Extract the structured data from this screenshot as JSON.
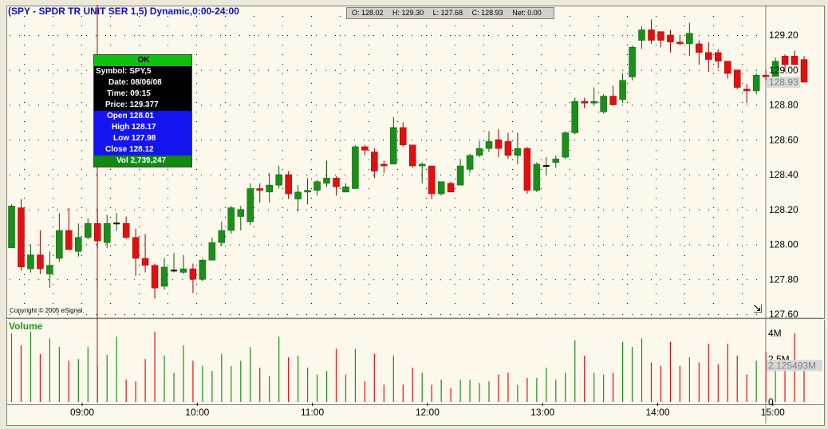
{
  "window": {
    "title": "(SPY - SPDR TR UNIT SER 1,5) Dynamic,0:00-24:00",
    "copyright": "Copyright © 2005 eSignal.",
    "volume_label": "Volume"
  },
  "ohlc_status": {
    "open": "O: 128.02",
    "high": "H: 129.30",
    "low": "L: 127.68",
    "close": "C: 128.93",
    "net": "Net:  0.00"
  },
  "cursor_popup": {
    "ok": "OK",
    "symbol": "Symbol: SPY,5",
    "date": "Date: 08/06/08",
    "time": "Time: 09:15",
    "price": "Price: 129.377",
    "open": "Open 128.01",
    "high": "High 128.17",
    "low": "Low 127.98",
    "close": "Close 128.12",
    "vol": "Vol 2,739,247"
  },
  "price_axis": {
    "ticks": [
      "129.20",
      "129.00",
      "128.80",
      "128.60",
      "128.40",
      "128.20",
      "128.00",
      "127.80",
      "127.60"
    ],
    "current_price_label": "128.93"
  },
  "volume_axis": {
    "ticks": [
      "4M",
      "2.5M",
      "0"
    ],
    "current_volume_label": "2.125493M"
  },
  "time_axis": {
    "ticks": [
      "09:00",
      "10:00",
      "11:00",
      "12:00",
      "13:00",
      "14:00",
      "15:00"
    ]
  },
  "colors": {
    "up": "#1a8f1a",
    "down": "#e01010",
    "background": "#fcf8ec",
    "grid_dot": "#000000"
  },
  "chart_data": {
    "type": "candlestick",
    "interval": "5 min",
    "x_start": "08:35",
    "ylim": [
      127.6,
      129.3
    ],
    "volume_ylim": [
      0,
      4300000
    ],
    "candles": [
      {
        "o": 127.98,
        "h": 128.23,
        "l": 127.98,
        "c": 128.22
      },
      {
        "o": 128.21,
        "h": 128.26,
        "l": 127.85,
        "c": 127.87
      },
      {
        "o": 127.86,
        "h": 128.0,
        "l": 127.84,
        "c": 127.94
      },
      {
        "o": 127.94,
        "h": 128.08,
        "l": 127.83,
        "c": 127.86
      },
      {
        "o": 127.83,
        "h": 127.96,
        "l": 127.75,
        "c": 127.88
      },
      {
        "o": 127.92,
        "h": 128.18,
        "l": 127.9,
        "c": 128.08
      },
      {
        "o": 128.08,
        "h": 128.21,
        "l": 128.03,
        "c": 127.97
      },
      {
        "o": 127.96,
        "h": 128.12,
        "l": 127.93,
        "c": 128.04
      },
      {
        "o": 128.04,
        "h": 128.15,
        "l": 128.03,
        "c": 128.12
      },
      {
        "o": 128.12,
        "h": 128.2,
        "l": 127.98,
        "c": 128.02
      },
      {
        "o": 128.01,
        "h": 128.17,
        "l": 127.98,
        "c": 128.12
      },
      {
        "o": 128.12,
        "h": 128.18,
        "l": 128.08,
        "c": 128.12
      },
      {
        "o": 128.12,
        "h": 128.16,
        "l": 128.03,
        "c": 128.04
      },
      {
        "o": 128.04,
        "h": 128.09,
        "l": 127.82,
        "c": 127.92
      },
      {
        "o": 127.92,
        "h": 128.06,
        "l": 127.84,
        "c": 127.88
      },
      {
        "o": 127.88,
        "h": 127.89,
        "l": 127.69,
        "c": 127.75
      },
      {
        "o": 127.76,
        "h": 127.92,
        "l": 127.74,
        "c": 127.87
      },
      {
        "o": 127.85,
        "h": 127.95,
        "l": 127.84,
        "c": 127.85
      },
      {
        "o": 127.84,
        "h": 127.94,
        "l": 127.83,
        "c": 127.86
      },
      {
        "o": 127.86,
        "h": 127.89,
        "l": 127.72,
        "c": 127.8
      },
      {
        "o": 127.8,
        "h": 127.92,
        "l": 127.79,
        "c": 127.91
      },
      {
        "o": 127.91,
        "h": 128.04,
        "l": 127.91,
        "c": 128.01
      },
      {
        "o": 128.01,
        "h": 128.13,
        "l": 127.99,
        "c": 128.08
      },
      {
        "o": 128.08,
        "h": 128.22,
        "l": 128.06,
        "c": 128.21
      },
      {
        "o": 128.16,
        "h": 128.22,
        "l": 128.08,
        "c": 128.2
      },
      {
        "o": 128.13,
        "h": 128.35,
        "l": 128.11,
        "c": 128.32
      },
      {
        "o": 128.32,
        "h": 128.35,
        "l": 128.24,
        "c": 128.31
      },
      {
        "o": 128.3,
        "h": 128.41,
        "l": 128.24,
        "c": 128.34
      },
      {
        "o": 128.34,
        "h": 128.45,
        "l": 128.32,
        "c": 128.4
      },
      {
        "o": 128.4,
        "h": 128.42,
        "l": 128.26,
        "c": 128.29
      },
      {
        "o": 128.26,
        "h": 128.34,
        "l": 128.19,
        "c": 128.3
      },
      {
        "o": 128.3,
        "h": 128.38,
        "l": 128.23,
        "c": 128.31
      },
      {
        "o": 128.31,
        "h": 128.37,
        "l": 128.28,
        "c": 128.36
      },
      {
        "o": 128.35,
        "h": 128.48,
        "l": 128.33,
        "c": 128.38
      },
      {
        "o": 128.38,
        "h": 128.39,
        "l": 128.28,
        "c": 128.33
      },
      {
        "o": 128.3,
        "h": 128.35,
        "l": 128.3,
        "c": 128.33
      },
      {
        "o": 128.32,
        "h": 128.57,
        "l": 128.32,
        "c": 128.56
      },
      {
        "o": 128.56,
        "h": 128.57,
        "l": 128.51,
        "c": 128.54
      },
      {
        "o": 128.53,
        "h": 128.55,
        "l": 128.38,
        "c": 128.42
      },
      {
        "o": 128.46,
        "h": 128.48,
        "l": 128.41,
        "c": 128.45
      },
      {
        "o": 128.46,
        "h": 128.73,
        "l": 128.46,
        "c": 128.67
      },
      {
        "o": 128.67,
        "h": 128.7,
        "l": 128.56,
        "c": 128.57
      },
      {
        "o": 128.57,
        "h": 128.57,
        "l": 128.44,
        "c": 128.45
      },
      {
        "o": 128.45,
        "h": 128.47,
        "l": 128.35,
        "c": 128.46
      },
      {
        "o": 128.45,
        "h": 128.45,
        "l": 128.26,
        "c": 128.29
      },
      {
        "o": 128.29,
        "h": 128.36,
        "l": 128.28,
        "c": 128.36
      },
      {
        "o": 128.35,
        "h": 128.36,
        "l": 128.3,
        "c": 128.3
      },
      {
        "o": 128.34,
        "h": 128.49,
        "l": 128.34,
        "c": 128.45
      },
      {
        "o": 128.43,
        "h": 128.52,
        "l": 128.41,
        "c": 128.51
      },
      {
        "o": 128.51,
        "h": 128.59,
        "l": 128.5,
        "c": 128.55
      },
      {
        "o": 128.55,
        "h": 128.65,
        "l": 128.53,
        "c": 128.59
      },
      {
        "o": 128.6,
        "h": 128.66,
        "l": 128.5,
        "c": 128.55
      },
      {
        "o": 128.59,
        "h": 128.64,
        "l": 128.49,
        "c": 128.51
      },
      {
        "o": 128.51,
        "h": 128.64,
        "l": 128.46,
        "c": 128.55
      },
      {
        "o": 128.55,
        "h": 128.56,
        "l": 128.29,
        "c": 128.31
      },
      {
        "o": 128.31,
        "h": 128.47,
        "l": 128.3,
        "c": 128.46
      },
      {
        "o": 128.45,
        "h": 128.5,
        "l": 128.4,
        "c": 128.45
      },
      {
        "o": 128.47,
        "h": 128.51,
        "l": 128.44,
        "c": 128.49
      },
      {
        "o": 128.5,
        "h": 128.65,
        "l": 128.49,
        "c": 128.64
      },
      {
        "o": 128.64,
        "h": 128.84,
        "l": 128.63,
        "c": 128.82
      },
      {
        "o": 128.82,
        "h": 128.84,
        "l": 128.78,
        "c": 128.81
      },
      {
        "o": 128.81,
        "h": 128.9,
        "l": 128.8,
        "c": 128.82
      },
      {
        "o": 128.76,
        "h": 128.86,
        "l": 128.75,
        "c": 128.85
      },
      {
        "o": 128.85,
        "h": 128.91,
        "l": 128.8,
        "c": 128.8
      },
      {
        "o": 128.83,
        "h": 128.98,
        "l": 128.81,
        "c": 128.94
      },
      {
        "o": 128.96,
        "h": 129.14,
        "l": 128.94,
        "c": 129.13
      },
      {
        "o": 129.17,
        "h": 129.25,
        "l": 129.12,
        "c": 129.23
      },
      {
        "o": 129.23,
        "h": 129.29,
        "l": 129.15,
        "c": 129.17
      },
      {
        "o": 129.22,
        "h": 129.21,
        "l": 129.13,
        "c": 129.17
      },
      {
        "o": 129.2,
        "h": 129.23,
        "l": 129.1,
        "c": 129.16
      },
      {
        "o": 129.16,
        "h": 129.2,
        "l": 129.14,
        "c": 129.15
      },
      {
        "o": 129.15,
        "h": 129.27,
        "l": 129.08,
        "c": 129.21
      },
      {
        "o": 129.15,
        "h": 129.17,
        "l": 129.03,
        "c": 129.1
      },
      {
        "o": 129.1,
        "h": 129.16,
        "l": 128.99,
        "c": 129.06
      },
      {
        "o": 129.1,
        "h": 129.12,
        "l": 129.01,
        "c": 129.05
      },
      {
        "o": 129.05,
        "h": 129.05,
        "l": 128.95,
        "c": 128.98
      },
      {
        "o": 129.0,
        "h": 129.0,
        "l": 128.89,
        "c": 128.9
      },
      {
        "o": 128.89,
        "h": 128.92,
        "l": 128.81,
        "c": 128.88
      },
      {
        "o": 128.88,
        "h": 128.98,
        "l": 128.86,
        "c": 128.97
      },
      {
        "o": 128.97,
        "h": 129.0,
        "l": 128.94,
        "c": 128.96
      },
      {
        "o": 128.96,
        "h": 129.07,
        "l": 128.96,
        "c": 129.05
      },
      {
        "o": 129.08,
        "h": 129.09,
        "l": 128.99,
        "c": 129.03
      },
      {
        "o": 129.08,
        "h": 129.11,
        "l": 129.03,
        "c": 129.03
      },
      {
        "o": 129.06,
        "h": 129.08,
        "l": 128.93,
        "c": 128.93
      }
    ],
    "volume": [
      4000000,
      3300000,
      4100000,
      2800000,
      3700000,
      3200000,
      2400000,
      2500000,
      3200000,
      2100000,
      2739247,
      3800000,
      1300000,
      1200000,
      2500000,
      4100000,
      2700000,
      1700000,
      3300000,
      2400000,
      2100000,
      1800000,
      2800000,
      2100000,
      2400000,
      3200000,
      2000000,
      1500000,
      3800000,
      2600000,
      2700000,
      2000000,
      1600000,
      1800000,
      3100000,
      1600000,
      3100000,
      1200000,
      2800000,
      1000000,
      2700000,
      1000000,
      2000000,
      1700000,
      1000000,
      1300000,
      800000,
      1300000,
      1300000,
      1100000,
      1200000,
      1600000,
      1700000,
      1000000,
      1400000,
      1400000,
      2000000,
      1300000,
      1700000,
      3600000,
      2700000,
      1700000,
      1600000,
      1700000,
      3500000,
      3200000,
      3700000,
      2300000,
      2100000,
      3500000,
      2100000,
      2600000,
      2300000,
      3400000,
      2200000,
      3400000,
      2700000,
      1600000,
      2400000,
      2900000,
      2300000,
      2100000,
      4000000,
      2125493
    ]
  }
}
